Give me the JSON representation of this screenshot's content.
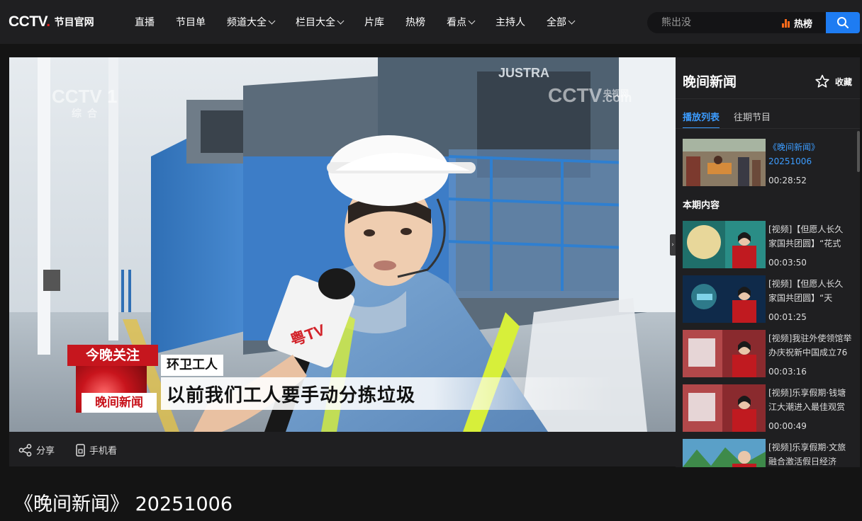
{
  "header": {
    "logo_text": "CCTV",
    "logo_sub": "节目官网",
    "nav": [
      {
        "label": "直播",
        "has_menu": false
      },
      {
        "label": "节目单",
        "has_menu": false
      },
      {
        "label": "频道大全",
        "has_menu": true
      },
      {
        "label": "栏目大全",
        "has_menu": true
      },
      {
        "label": "片库",
        "has_menu": false
      },
      {
        "label": "热榜",
        "has_menu": false
      },
      {
        "label": "看点",
        "has_menu": true
      },
      {
        "label": "主持人",
        "has_menu": false
      },
      {
        "label": "全部",
        "has_menu": true
      }
    ],
    "search_placeholder": "熊出没",
    "hot_label": "热榜"
  },
  "player": {
    "watermark_left": "CCTV 1",
    "watermark_left_sub": "综合",
    "watermark_right": "CCTV",
    "watermark_right_small": "央视网",
    "watermark_right_com": ".com",
    "tonight_top": "今晚关注",
    "tonight_bottom": "晚间新闻",
    "caption_role": "环卫工人",
    "caption_text": "以前我们工人要手动分拣垃圾"
  },
  "controls": {
    "share": "分享",
    "mobile": "手机看"
  },
  "sidebar": {
    "title": "晚间新闻",
    "favorite": "收藏",
    "tabs": [
      "播放列表",
      "往期节目"
    ],
    "active_tab": "播放列表",
    "current": {
      "title": "《晚间新闻》20251006",
      "duration": "00:28:52"
    },
    "section_label": "本期内容",
    "items": [
      {
        "title": "[视频]【但愿人长久 家国共团圆】“花式",
        "duration": "00:03:50"
      },
      {
        "title": "[视频]【但愿人长久 家国共团圆】“天",
        "duration": "00:01:25"
      },
      {
        "title": "[视频]我驻外使领馆举办庆祝新中国成立76",
        "duration": "00:03:16"
      },
      {
        "title": "[视频]乐享假期·钱塘江大潮进入最佳观赏",
        "duration": "00:00:49"
      },
      {
        "title": "[视频]乐享假期·文旅融合激活假日经济",
        "duration": ""
      }
    ]
  },
  "page_title": "《晚间新闻》 20251006",
  "colors": {
    "accent_blue": "#1e7cf2",
    "link_blue": "#3c9cff",
    "hot_orange": "#ff6a1a",
    "news_red": "#c6161e",
    "bg": "#141414",
    "panel": "#1f1f21"
  }
}
